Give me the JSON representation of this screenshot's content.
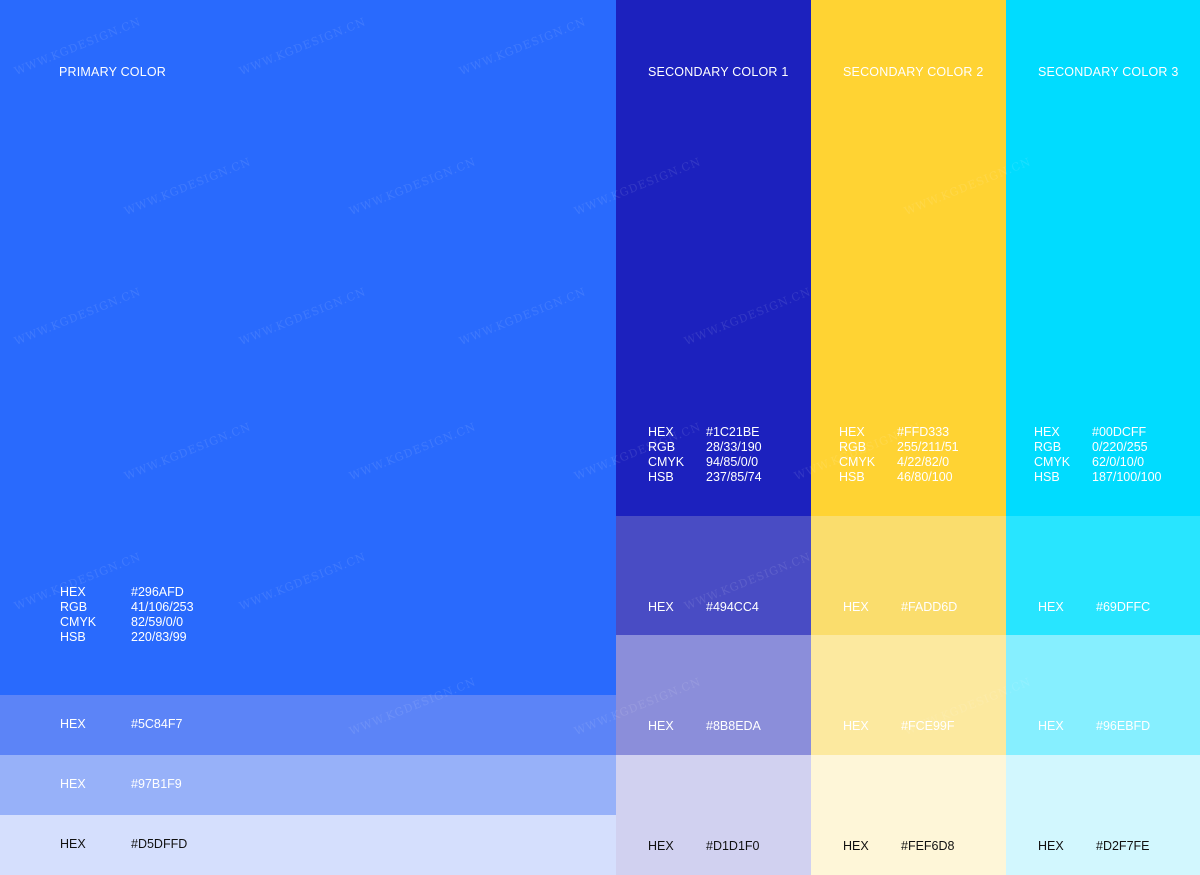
{
  "watermark_text": "WWW.KGDESIGN.CN",
  "primary": {
    "title": "PRIMARY COLOR",
    "main_color": "#296AFD",
    "specs": [
      {
        "key": "HEX",
        "value": "#296AFD"
      },
      {
        "key": "RGB",
        "value": "41/106/253"
      },
      {
        "key": "CMYK",
        "value": "82/59/0/0"
      },
      {
        "key": "HSB",
        "value": "220/83/99"
      }
    ],
    "tints": [
      {
        "key": "HEX",
        "value": "#5C84F7"
      },
      {
        "key": "HEX",
        "value": "#97B1F9"
      },
      {
        "key": "HEX",
        "value": "#D5DFFD"
      }
    ]
  },
  "secondary1": {
    "title": "SECONDARY COLOR 1",
    "main_color": "#1C21BE",
    "specs": [
      {
        "key": "HEX",
        "value": "#1C21BE"
      },
      {
        "key": "RGB",
        "value": "28/33/190"
      },
      {
        "key": "CMYK",
        "value": "94/85/0/0"
      },
      {
        "key": "HSB",
        "value": "237/85/74"
      }
    ],
    "tints": [
      {
        "key": "HEX",
        "value": "#494CC4"
      },
      {
        "key": "HEX",
        "value": "#8B8EDA"
      },
      {
        "key": "HEX",
        "value": "#D1D1F0"
      }
    ]
  },
  "secondary2": {
    "title": "SECONDARY COLOR 2",
    "main_color": "#FFD333",
    "specs": [
      {
        "key": "HEX",
        "value": "#FFD333"
      },
      {
        "key": "RGB",
        "value": "255/211/51"
      },
      {
        "key": "CMYK",
        "value": "4/22/82/0"
      },
      {
        "key": "HSB",
        "value": "46/80/100"
      }
    ],
    "tints": [
      {
        "key": "HEX",
        "value": "#FADD6D"
      },
      {
        "key": "HEX",
        "value": "#FCE99F"
      },
      {
        "key": "HEX",
        "value": "#FEF6D8"
      }
    ]
  },
  "secondary3": {
    "title": "SECONDARY COLOR 3",
    "main_color": "#00DCFF",
    "specs": [
      {
        "key": "HEX",
        "value": "#00DCFF"
      },
      {
        "key": "RGB",
        "value": "0/220/255"
      },
      {
        "key": "CMYK",
        "value": "62/0/10/0"
      },
      {
        "key": "HSB",
        "value": "187/100/100"
      }
    ],
    "tints": [
      {
        "key": "HEX",
        "value": "#69DFFC"
      },
      {
        "key": "HEX",
        "value": "#96EBFD"
      },
      {
        "key": "HEX",
        "value": "#D2F7FE"
      }
    ]
  }
}
